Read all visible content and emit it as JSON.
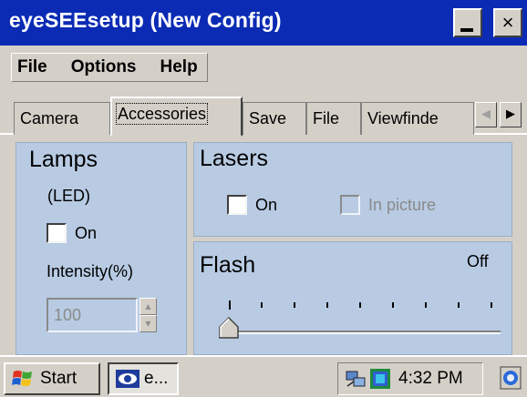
{
  "window": {
    "title": "eyeSEEsetup (New Config)",
    "minimize_icon": "minimize-icon",
    "close_glyph": "×"
  },
  "menu": {
    "items": [
      "File",
      "Options",
      "Help"
    ]
  },
  "tabs": {
    "items": [
      {
        "label": "Camera"
      },
      {
        "label": "Accessories"
      },
      {
        "label": "Save"
      },
      {
        "label": "File"
      },
      {
        "label": "Viewfinde"
      }
    ],
    "selected": "Accessories",
    "scroll_left_glyph": "◀",
    "scroll_right_glyph": "▶"
  },
  "lamps": {
    "heading": "Lamps",
    "subtitle": "(LED)",
    "on_label": "On",
    "on_checked": false,
    "intensity_label": "Intensity(%)",
    "intensity_value": "100",
    "intensity_enabled": false
  },
  "lasers": {
    "heading": "Lasers",
    "on_label": "On",
    "on_checked": false,
    "in_picture_label": "In picture",
    "in_picture_enabled": false
  },
  "flash": {
    "heading": "Flash",
    "value_text": "Off",
    "slider_fraction": 0
  },
  "taskbar": {
    "start_label": "Start",
    "task_label": "e...",
    "clock": "4:32 PM"
  },
  "colors": {
    "titlebar": "#0b2bb4",
    "panel": "#b8cbe3",
    "chrome": "#d4d0c8"
  }
}
